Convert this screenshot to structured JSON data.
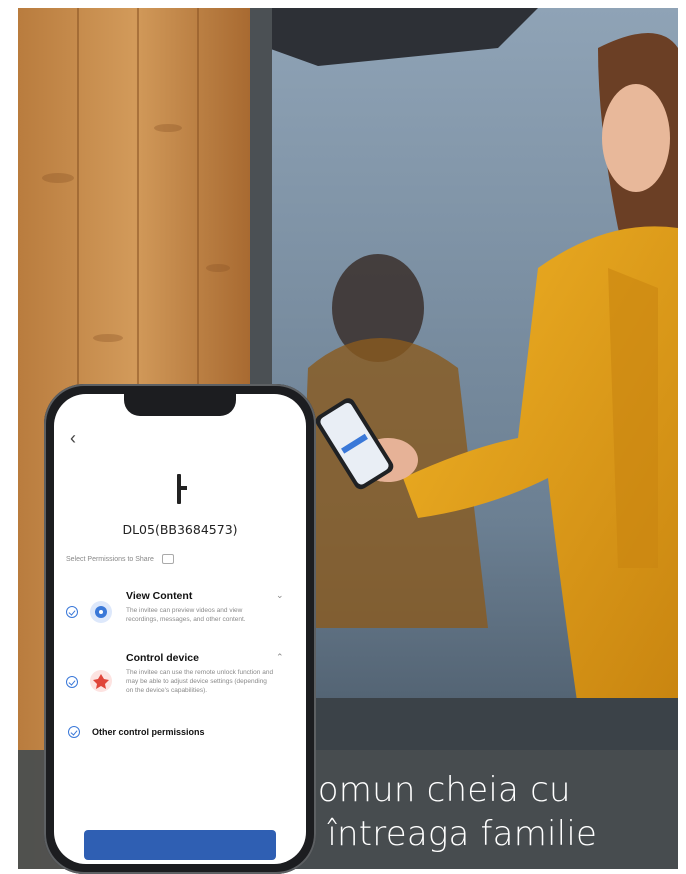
{
  "caption": {
    "line1": "Folosiți la comun cheia cu",
    "line2": "Bluetooth cu întreaga familie"
  },
  "phone": {
    "device_name": "DL05(BB3684573)",
    "select_text": "Select Permissions to Share",
    "permissions": [
      {
        "title": "View Content",
        "description": "The invitee can preview videos and view recordings, messages, and other content.",
        "icon": "eye-icon",
        "expand_icon": "chevron-down-icon"
      },
      {
        "title": "Control device",
        "description": "The invitee can use the remote unlock function and may be able to adjust device settings (depending on the device's capabilities).",
        "icon": "remote-control-icon",
        "expand_icon": "chevron-up-icon"
      }
    ],
    "other_permissions": "Other control permissions"
  },
  "colors": {
    "accent": "#3a78d8",
    "jacket": "#e3a21c",
    "caption_band": "#484e50"
  }
}
